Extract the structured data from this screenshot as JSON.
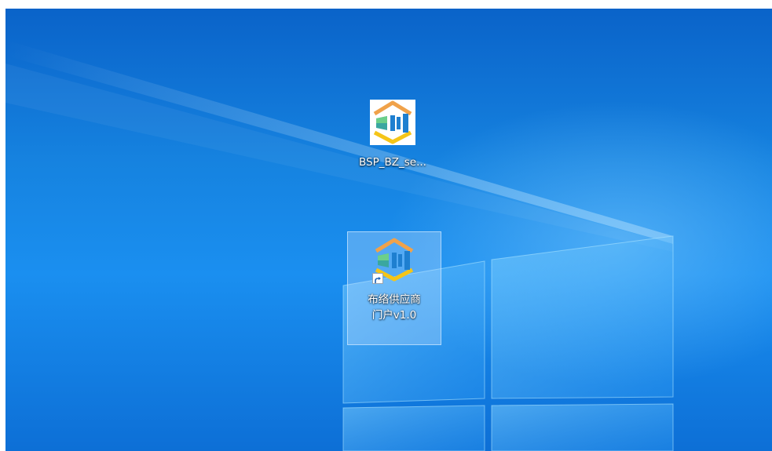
{
  "desktop": {
    "icons": [
      {
        "label": "BSP_BZ_se...",
        "icon": "app-logo-icon",
        "selected": false
      },
      {
        "label_lines": [
          "布络供应商",
          "门户v1.0"
        ],
        "icon": "app-logo-icon",
        "shortcut": true,
        "selected": true
      }
    ]
  },
  "colors": {
    "wallpaper_dark": "#0a63c9",
    "wallpaper_mid": "#1a8ff0",
    "logo_orange": "#f0a24a",
    "logo_yellow": "#f5c518",
    "logo_teal": "#3aa7a0",
    "logo_blue": "#1e7fd0",
    "selection": "#bedcff"
  }
}
